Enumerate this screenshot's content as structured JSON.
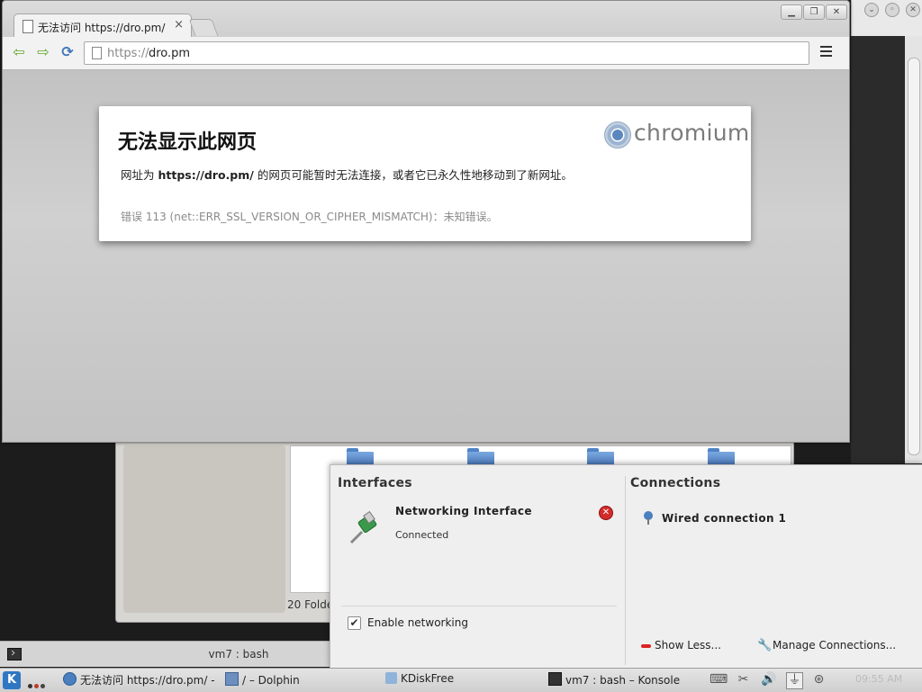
{
  "browser": {
    "tab_title": "无法访问 https://dro.pm/",
    "tab_close": "×",
    "url_scheme": "https://",
    "url_host": "dro.pm",
    "window_controls": [
      "▁",
      "❐",
      "✕"
    ]
  },
  "error_page": {
    "title": "无法显示此网页",
    "desc_prefix": "网址为 ",
    "desc_url": "https://dro.pm/",
    "desc_suffix": " 的网页可能暂时无法连接，或者它已永久性地移动到了新网址。",
    "error_code": "错误 113 (net::ERR_SSL_VERSION_OR_CIPHER_MISMATCH)：未知错误。",
    "brand": "chromium"
  },
  "dolphin": {
    "status": "20 Folde"
  },
  "konsole_bar": {
    "title": "vm7 : bash"
  },
  "network_popup": {
    "interfaces_title": "Interfaces",
    "connections_title": "Connections",
    "interface_name": "Networking Interface",
    "interface_status": "Connected",
    "enable_networking": "Enable networking",
    "wired_connection": "Wired connection 1",
    "show_less": "Show Less...",
    "manage_connections": "Manage Connections..."
  },
  "taskbar": {
    "kmenu": "K",
    "tasks": [
      {
        "label": "无法访问 https://dro.pm/ -",
        "icon": "chromium-icon"
      },
      {
        "label": "/ – Dolphin",
        "icon": "dolphin-icon"
      },
      {
        "label": "KDiskFree",
        "icon": "kdiskfree-icon"
      },
      {
        "label": "vm7 : bash – Konsole",
        "icon": "konsole-icon"
      }
    ],
    "tray_icons": [
      "keyboard-icon",
      "klipper-icon",
      "volume-icon",
      "network-icon",
      "update-icon"
    ],
    "clock": "09:55 AM"
  },
  "colors": {
    "accent": "#2f77c3",
    "nav_green": "#5ca629",
    "error_red": "#d32b2b"
  }
}
